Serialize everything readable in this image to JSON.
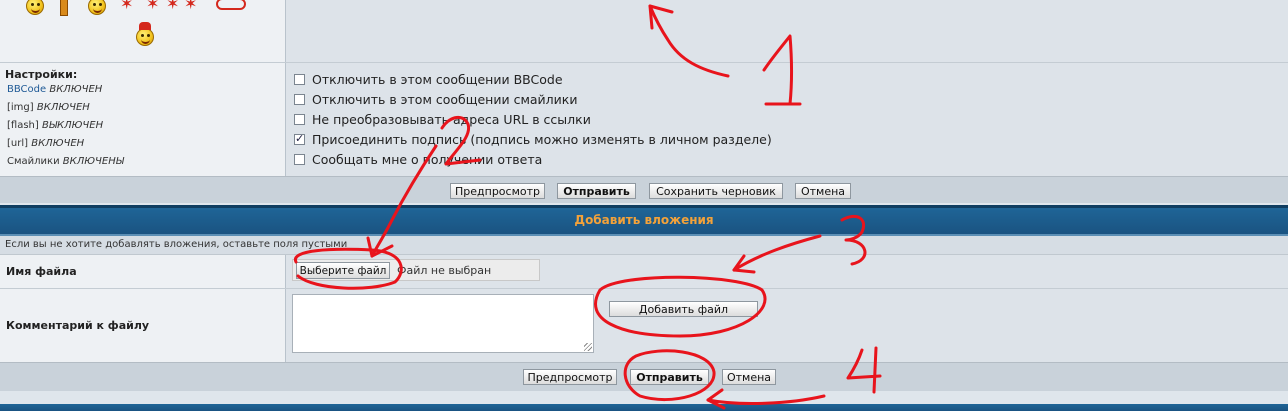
{
  "settings": {
    "heading": "Настройки:",
    "lines": [
      {
        "key": "BBCode",
        "state": "ВКЛЮЧЕН"
      },
      {
        "key": "[img]",
        "state": "ВКЛЮЧЕН"
      },
      {
        "key": "[flash]",
        "state": "ВЫКЛЮЧЕН"
      },
      {
        "key": "[url]",
        "state": "ВКЛЮЧЕН"
      },
      {
        "key": "Смайлики",
        "state": "ВКЛЮЧЕНЫ"
      }
    ]
  },
  "options": [
    {
      "label": "Отключить в этом сообщении BBCode",
      "checked": false
    },
    {
      "label": "Отключить в этом сообщении смайлики",
      "checked": false
    },
    {
      "label": "Не преобразовывать адреса URL в ссылки",
      "checked": false
    },
    {
      "label": "Присоединить подпись (подпись можно изменять в личном разделе)",
      "checked": true
    },
    {
      "label": "Сообщать мне о получении ответа",
      "checked": false
    }
  ],
  "post_buttons": {
    "preview": "Предпросмотр",
    "submit": "Отправить",
    "save_draft": "Сохранить черновик",
    "cancel": "Отмена"
  },
  "attachments": {
    "title": "Добавить вложения",
    "hint": "Если вы не хотите добавлять вложения, оставьте поля пустыми",
    "filename_label": "Имя файла",
    "choose_file": "Выберите файл",
    "no_file": "Файл не выбран",
    "comment_label": "Комментарий к файлу",
    "add_file": "Добавить файл",
    "buttons": {
      "preview": "Предпросмотр",
      "submit": "Отправить",
      "cancel": "Отмена"
    }
  },
  "annotations": {
    "numbers": [
      "1",
      "2",
      "3",
      "4"
    ],
    "color": "#e8141c"
  },
  "colors": {
    "header_bar": "#1f6597",
    "header_text": "#f3a23a",
    "link_blue": "#1f5a96"
  }
}
